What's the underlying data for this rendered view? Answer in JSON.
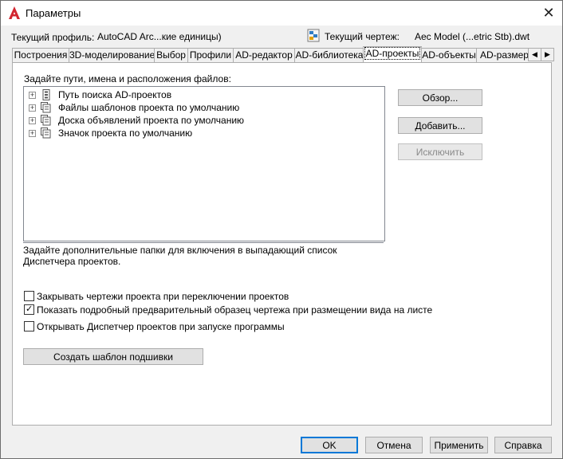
{
  "window": {
    "title": "Параметры",
    "app_icon": "autocad-a-icon",
    "close_glyph": "✕",
    "accent": "#d22630"
  },
  "profile": {
    "label": "Текущий профиль:",
    "value": "AutoCAD Arc...кие единицы)"
  },
  "drawing": {
    "label": "Текущий чертеж:",
    "value": "Aec Model (...etric Stb).dwt",
    "icon": "drawing-file-icon"
  },
  "tabs": [
    {
      "label": "Построения"
    },
    {
      "label": "3D-моделирование"
    },
    {
      "label": "Выбор"
    },
    {
      "label": "Профили"
    },
    {
      "label": "AD-редактор"
    },
    {
      "label": "AD-библиотека"
    },
    {
      "label": "AD-проекты"
    },
    {
      "label": "AD-объекты"
    },
    {
      "label": "AD-размеры"
    }
  ],
  "active_tab": "AD-проекты",
  "tab_scroll": {
    "left": "◀",
    "right": "▶"
  },
  "paths_section": {
    "label": "Задайте пути, имена и расположения файлов:",
    "items": [
      {
        "label": "Путь поиска AD-проектов",
        "icon": "search-path-icon",
        "expander": "+"
      },
      {
        "label": "Файлы шаблонов проекта по умолчанию",
        "icon": "folders-icon",
        "expander": "+"
      },
      {
        "label": "Доска объявлений проекта по умолчанию",
        "icon": "folders-icon",
        "expander": "+"
      },
      {
        "label": "Значок проекта по умолчанию",
        "icon": "folders-icon",
        "expander": "+"
      }
    ]
  },
  "buttons": {
    "browse": "Обзор...",
    "add": "Добавить...",
    "remove": "Исключить"
  },
  "description": "Задайте дополнительные папки для включения в выпадающий список Диспетчера проектов.",
  "checkboxes": [
    {
      "label": "Закрывать чертежи проекта при переключении проектов",
      "checked": false
    },
    {
      "label": "Показать подробный предварительный образец чертежа при размещении вида на листе",
      "checked": true
    },
    {
      "label": "Открывать Диспетчер проектов при запуске программы",
      "checked": false
    }
  ],
  "create_template_button": "Создать шаблон подшивки",
  "footer": {
    "ok": "OK",
    "cancel": "Отмена",
    "apply": "Применить",
    "help": "Справка"
  }
}
